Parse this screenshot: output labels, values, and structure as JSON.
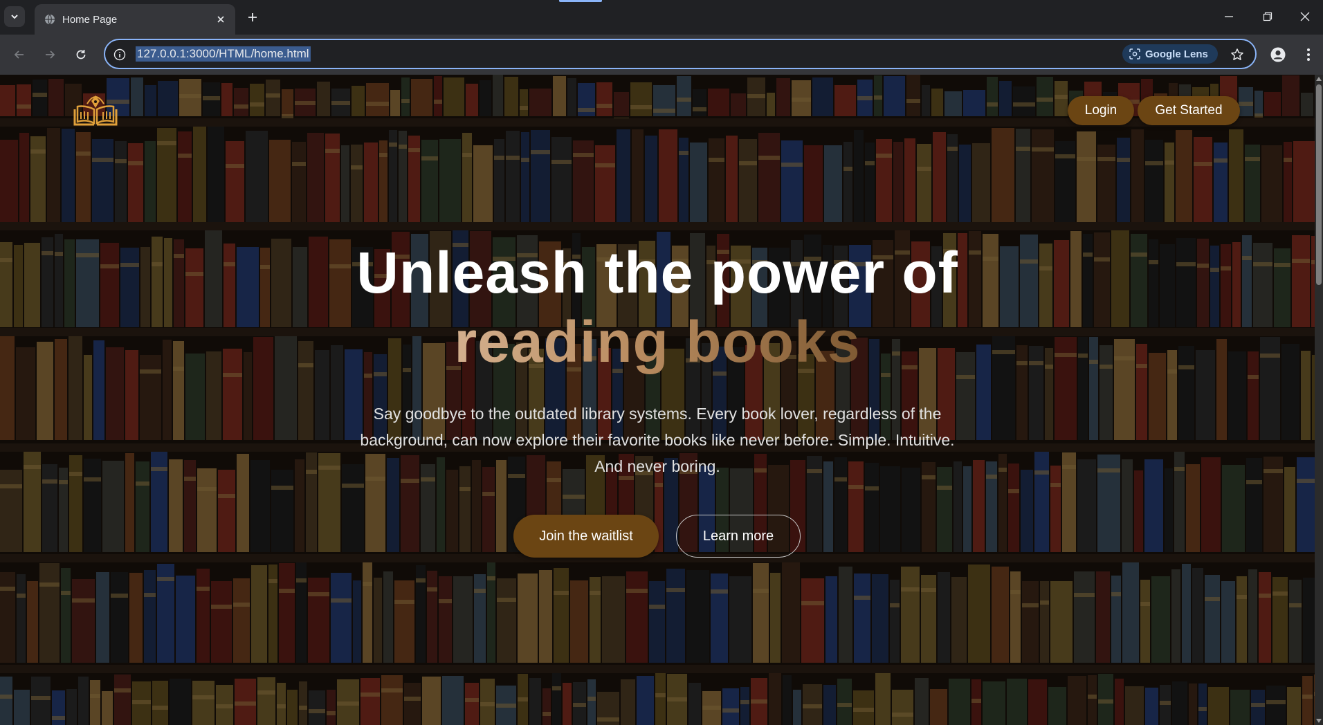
{
  "browser": {
    "tab_title": "Home Page",
    "url": "127.0.0.1:3000/HTML/home.html",
    "lens_label": "Google Lens"
  },
  "page": {
    "nav": {
      "login": "Login",
      "get_started": "Get Started"
    },
    "hero": {
      "line1": "Unleash the power of",
      "line2": "reading books",
      "subtitle": "Say goodbye to the outdated library systems. Every book lover, regardless of the background, can now explore their favorite books like never before. Simple. Intuitive. And never boring.",
      "primary_cta": "Join the waitlist",
      "secondary_cta": "Learn more"
    },
    "colors": {
      "accent_brown": "#6b4513",
      "logo_orange": "#e0a03a"
    }
  }
}
